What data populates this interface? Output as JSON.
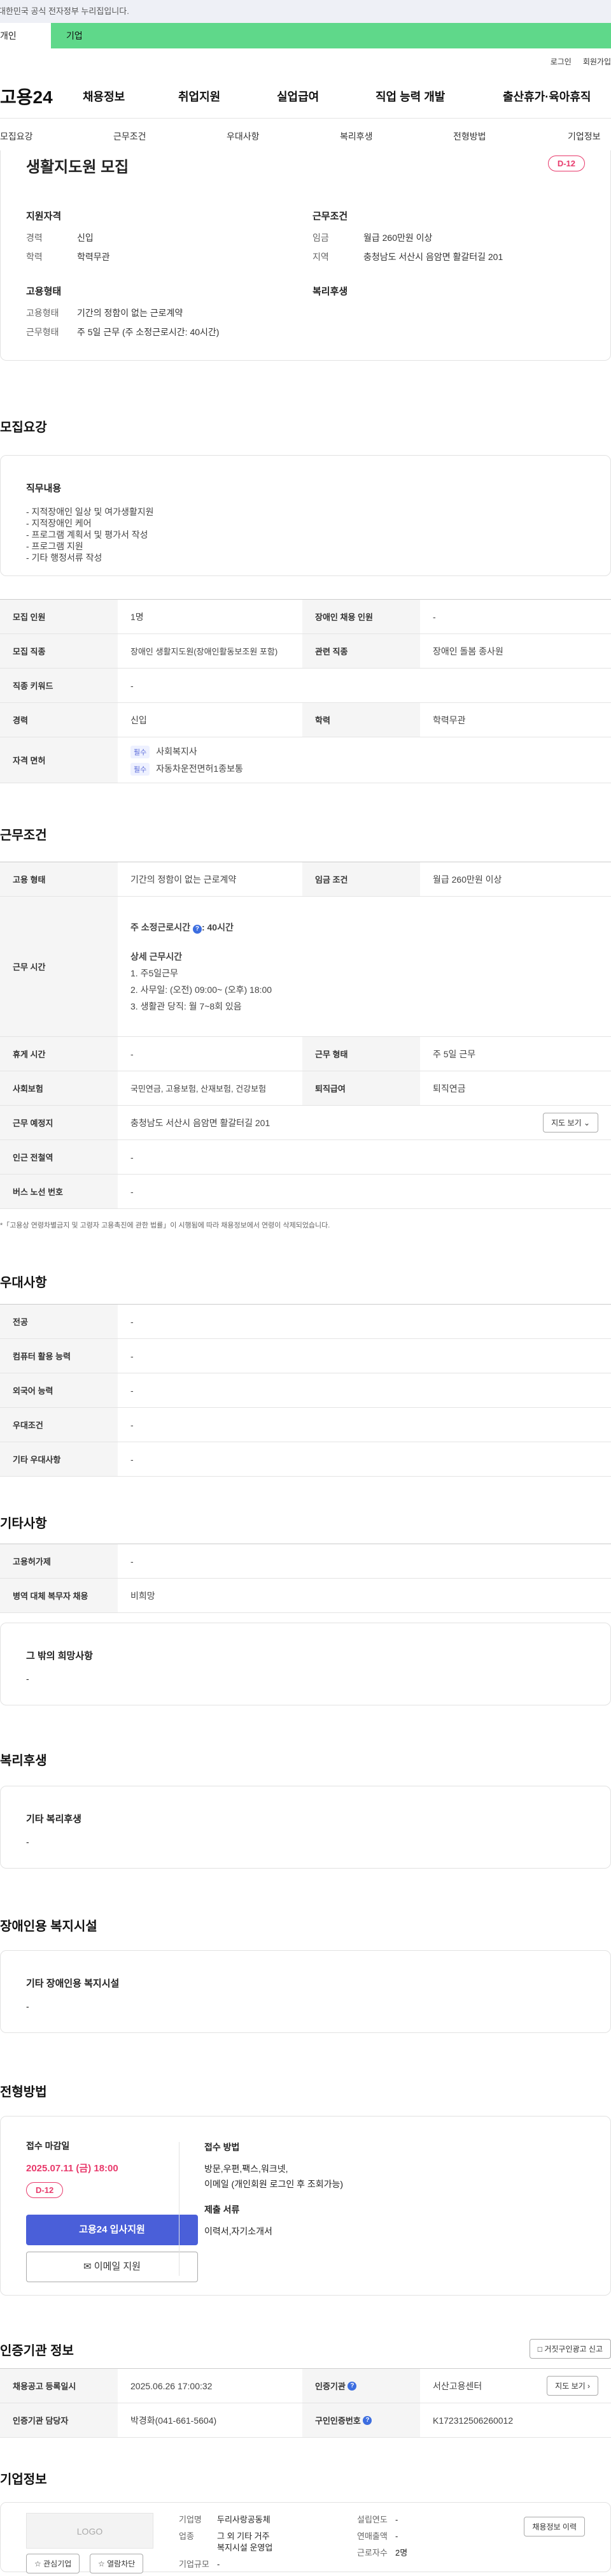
{
  "banner": "이 누리집은 대한민국 공식 전자정부 누리집입니다.",
  "top_tabs": [
    "개인",
    "기업"
  ],
  "util_links": [
    "로그인",
    "회원가입"
  ],
  "logo": "고용24",
  "gnb": [
    "채용정보",
    "취업지원",
    "실업급여",
    "직업 능력 개발",
    "출산휴가·육아휴직"
  ],
  "subnav": [
    "모집요강",
    "근무조건",
    "우대사항",
    "복리후생",
    "전형방법",
    "기업정보"
  ],
  "summary": {
    "title": "생활지도원 모집",
    "dday": "D-12",
    "qualification": {
      "heading": "지원자격",
      "career_k": "경력",
      "career_v": "신입",
      "edu_k": "학력",
      "edu_v": "학력무관"
    },
    "condition": {
      "heading": "근무조건",
      "wage_k": "임금",
      "wage_v": "월급 260만원 이상",
      "area_k": "지역",
      "area_v": "충청남도 서산시 음암면 활갈터길 201"
    },
    "employment": {
      "heading": "고용형태",
      "type_k": "고용형태",
      "type_v": "기간의 정함이 없는 근로계약",
      "shift_k": "근무형태",
      "shift_v": "주 5일 근무 (주 소정근로시간: 40시간)"
    },
    "welfare": {
      "heading": "복리후생"
    }
  },
  "recruit": {
    "title": "모집요강",
    "duty_heading": "직무내용",
    "duties": [
      "- 지적장애인 일상 및 여가생활지원",
      "- 지적장애인 케어",
      "- 프로그램 계획서 및 평가서 작성",
      "- 프로그램 지원",
      "- 기타 행정서류 작성"
    ],
    "rows": {
      "count_k": "모집 인원",
      "count_v": "1명",
      "disabled_k": "장애인 채용 인원",
      "disabled_v": "-",
      "job_k": "모집 직종",
      "job_v": "장애인 생활지도원(장애인활동보조원 포함)",
      "rel_k": "관련 직종",
      "rel_v": "장애인 돌봄 종사원",
      "kw_k": "직종 키워드",
      "kw_v": "-",
      "career_k": "경력",
      "career_v": "신입",
      "edu_k": "학력",
      "edu_v": "학력무관",
      "license_k": "자격 면허",
      "license_tag": "필수",
      "license1": "사회복지사",
      "license2": "자동차운전면허1종보통"
    }
  },
  "work": {
    "title": "근무조건",
    "type_k": "고용 형태",
    "type_v": "기간의 정함이 없는 근로계약",
    "wage_k": "임금 조건",
    "wage_v": "월급 260만원 이상",
    "hours_k": "근무 시간",
    "hours_title": "주 소정근로시간",
    "hours_value": ": 40시간",
    "detail_title": "상세 근무시간",
    "detail": [
      "1. 주5일근무",
      "2. 사무일: (오전) 09:00~ (오후) 18:00",
      "3. 생활관 당직: 월 7~8회 있음"
    ],
    "rest_k": "휴게 시간",
    "rest_v": "-",
    "shift_k": "근무 형태",
    "shift_v": "주 5일 근무",
    "ins_k": "사회보험",
    "ins_v": "국민연금, 고용보험, 산재보험, 건강보험",
    "ret_k": "퇴직급여",
    "ret_v": "퇴직연금",
    "place_k": "근무 예정지",
    "place_v": "충청남도 서산시 음암면 활갈터길 201",
    "map_btn": "지도 보기",
    "station_k": "인근 전철역",
    "station_v": "-",
    "bus_k": "버스 노선 번호",
    "bus_v": "-",
    "note": "*「고용상 연령차별금지 및 고령자 고용촉진에 관한 법률」이 시행됨에 따라 채용정보에서 연령이 삭제되었습니다."
  },
  "pref": {
    "title": "우대사항",
    "rows": [
      [
        "전공",
        "-"
      ],
      [
        "컴퓨터 활용 능력",
        "-"
      ],
      [
        "외국어 능력",
        "-"
      ],
      [
        "우대조건",
        "-"
      ],
      [
        "기타 우대사항",
        "-"
      ]
    ]
  },
  "etc": {
    "title": "기타사항",
    "rows": [
      [
        "고용허가제",
        "-"
      ],
      [
        "병역 대체 복무자 채용",
        "비희망"
      ]
    ],
    "wish_title": "그 밖의 희망사항",
    "wish_v": "-"
  },
  "welfare": {
    "title": "복리후생",
    "sub": "기타 복리후생",
    "v": "-"
  },
  "facility": {
    "title": "장애인용 복지시설",
    "sub": "기타 장애인용 복지시설",
    "v": "-"
  },
  "selection": {
    "title": "전형방법",
    "deadline_k": "접수 마감일",
    "deadline_v": "2025.07.11 (금) 18:00",
    "dday": "D-12",
    "apply_btn": "고용24 입사지원",
    "mail_btn": "이메일 지원",
    "method_k": "접수 방법",
    "method_v1": "방문,우편,팩스,워크넷,",
    "method_v2": "이메일 (개인회원 로그인 후 조회가능)",
    "docs_k": "제출 서류",
    "docs_v": "이력서,자기소개서"
  },
  "auth": {
    "title": "인증기관 정보",
    "report_btn": "거짓구인광고 신고",
    "reg_k": "채용공고 등록일시",
    "reg_v": "2025.06.26 17:00:32",
    "org_k": "인증기관",
    "org_v": "서산고용센터",
    "map_btn": "지도 보기",
    "mgr_k": "인증기관 담당자",
    "mgr_v": "박경화(041-661-5604)",
    "no_k": "구인인증번호",
    "no_v": "K172312506260012"
  },
  "company": {
    "title": "기업정보",
    "logo_text": "LOGO",
    "fav_btn": "관심기업",
    "block_btn": "열람차단",
    "name_k": "기업명",
    "name_v": "두리사랑공동체",
    "biz_k": "업종",
    "biz_v1": "그 외 기타 거주",
    "biz_v2": "복지시설 운영업",
    "size_k": "기업규모",
    "size_v": "-",
    "est_k": "설립연도",
    "est_v": "-",
    "sales_k": "연매출액",
    "sales_v": "-",
    "emp_k": "근로자수",
    "emp_v": "2명",
    "history_btn": "채용정보 이력"
  }
}
